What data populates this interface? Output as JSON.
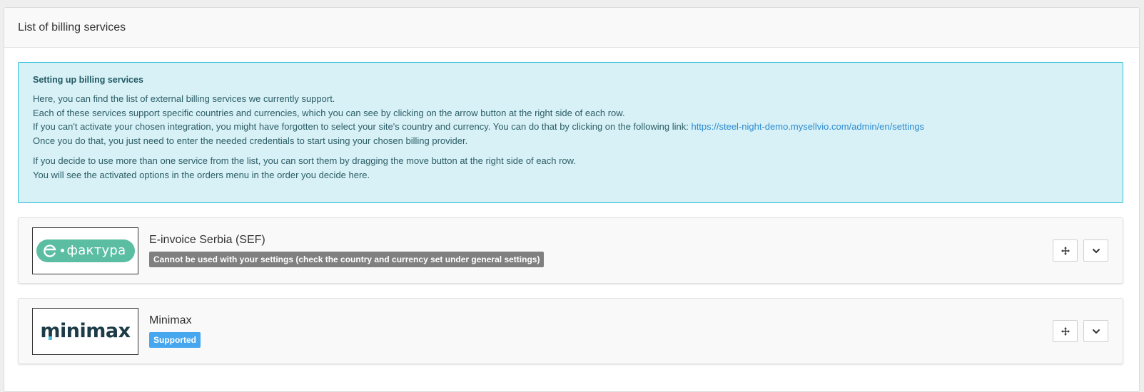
{
  "panel": {
    "title": "List of billing services"
  },
  "info": {
    "title": "Setting up billing services",
    "line1": "Here, you can find the list of external billing services we currently support.",
    "line2": "Each of these services support specific countries and currencies, which you can see by clicking on the arrow button at the right side of each row.",
    "line3_prefix": "If you can't activate your chosen integration, you might have forgotten to select your site's country and currency. You can do that by clicking on the following link: ",
    "line3_link": "https://steel-night-demo.mysellvio.com/admin/en/settings",
    "line4": "Once you do that, you just need to enter the needed credentials to start using your chosen billing provider.",
    "line5": "If you decide to use more than one service from the list, you can sort them by dragging the move button at the right side of each row.",
    "line6": "You will see the activated options in the orders menu in the order you decide here."
  },
  "services": [
    {
      "name": "E-invoice Serbia (SEF)",
      "logo_text": "фактура",
      "badge": "Cannot be used with your settings (check the country and currency set under general settings)",
      "badge_color": "#808080"
    },
    {
      "name": "Minimax",
      "logo_text": "minimax",
      "badge": "Supported",
      "badge_color": "#46a7ef"
    }
  ],
  "icons": {
    "move": "move-icon",
    "expand": "chevron-down-icon"
  },
  "colors": {
    "info_background": "#d7f1f6",
    "info_border": "#2cc1d6",
    "link": "#2e8bd1",
    "efaktura_green": "#5bbda2",
    "minimax_navy": "#1d3b47"
  }
}
